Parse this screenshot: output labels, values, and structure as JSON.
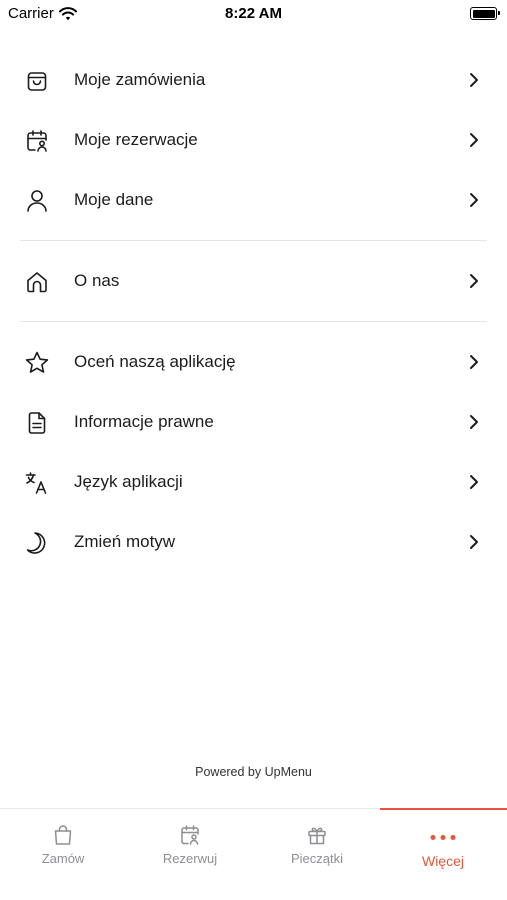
{
  "status_bar": {
    "carrier": "Carrier",
    "time": "8:22 AM"
  },
  "menu": {
    "group1": [
      {
        "label": "Moje zamówienia",
        "icon": "shopping-bag-icon"
      },
      {
        "label": "Moje rezerwacje",
        "icon": "calendar-user-icon"
      },
      {
        "label": "Moje dane",
        "icon": "user-icon"
      }
    ],
    "group2": [
      {
        "label": "O nas",
        "icon": "home-icon"
      }
    ],
    "group3": [
      {
        "label": "Oceń naszą aplikację",
        "icon": "star-icon"
      },
      {
        "label": "Informacje prawne",
        "icon": "document-icon"
      },
      {
        "label": "Język aplikacji",
        "icon": "translate-icon"
      },
      {
        "label": "Zmień motyw",
        "icon": "moon-icon"
      }
    ]
  },
  "footer": {
    "powered_by": "Powered by UpMenu"
  },
  "tabbar": {
    "tabs": [
      {
        "label": "Zamów",
        "icon": "shopping-bag-icon"
      },
      {
        "label": "Rezerwuj",
        "icon": "calendar-user-icon"
      },
      {
        "label": "Pieczątki",
        "icon": "gift-icon"
      },
      {
        "label": "Więcej",
        "icon": "more-dots-icon"
      }
    ],
    "active_index": 3
  },
  "colors": {
    "accent": "#e8553a",
    "text": "#1c1c1e",
    "inactive_tab": "#8e8e93",
    "divider": "#e6e6e6"
  }
}
